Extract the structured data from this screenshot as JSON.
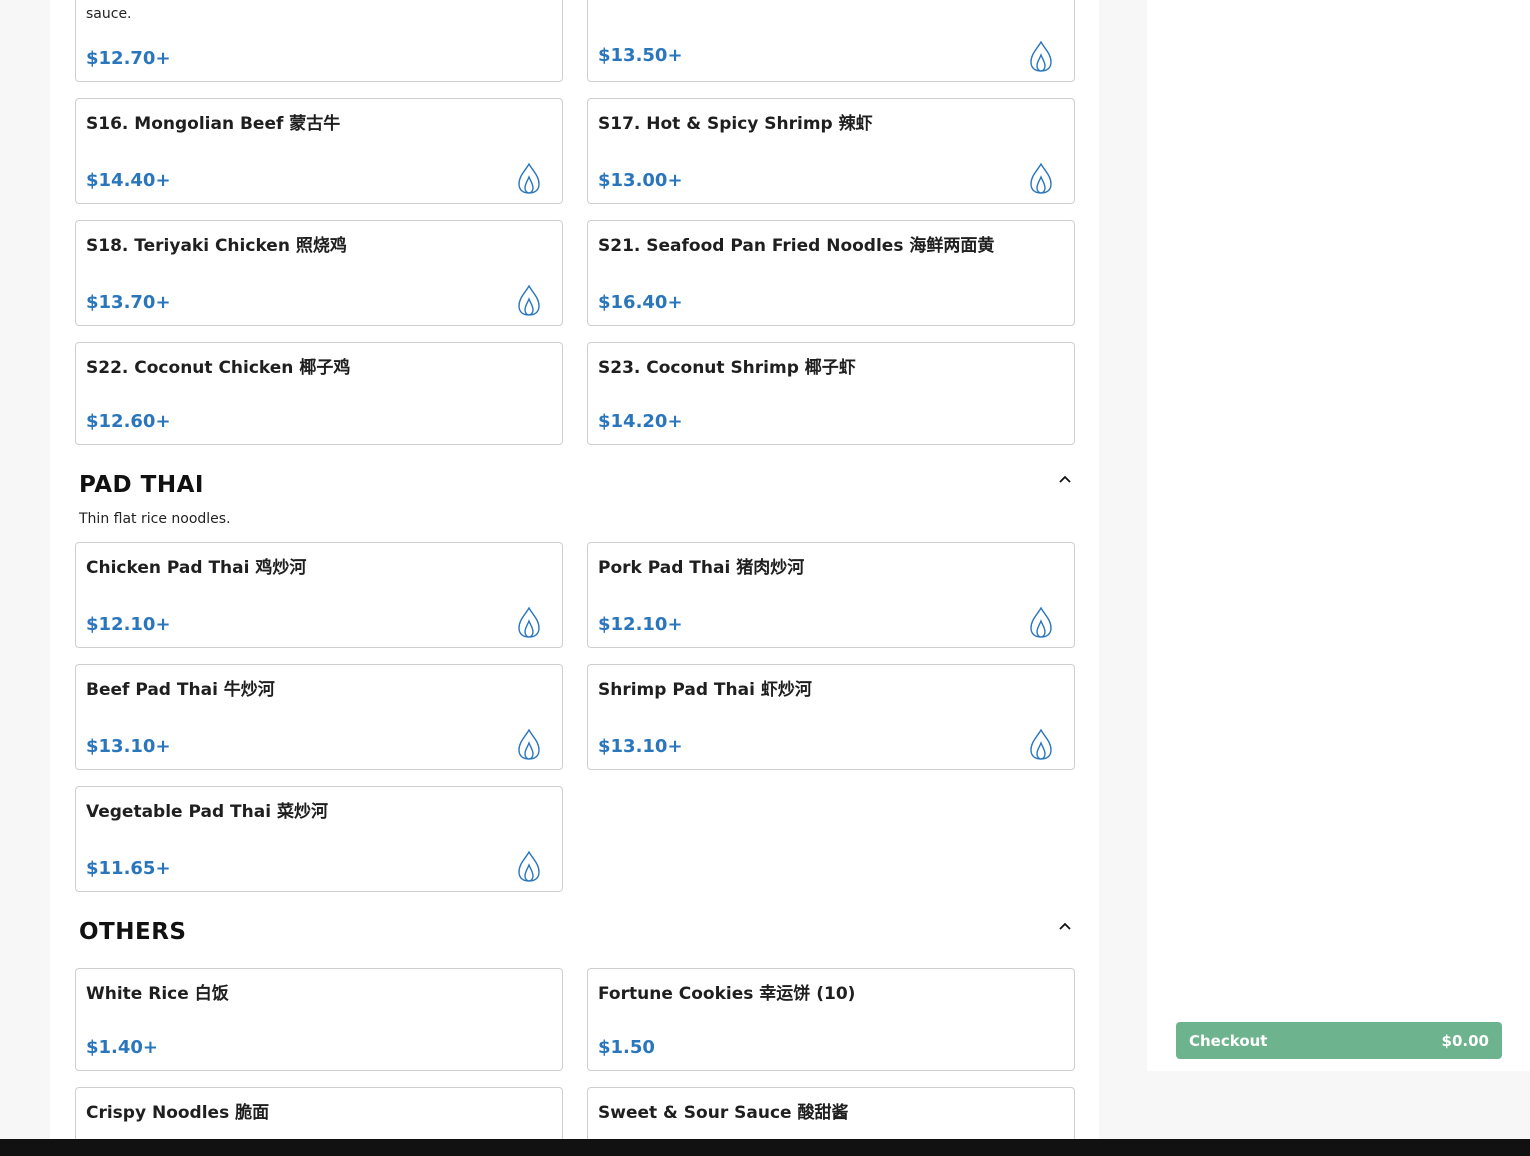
{
  "top_cards": [
    {
      "desc": "sauce.",
      "price": "$12.70+",
      "spicy": false
    },
    {
      "desc": "",
      "price": "$13.50+",
      "spicy": true
    }
  ],
  "sections": [
    {
      "items": [
        {
          "name": "S16. Mongolian Beef 蒙古牛",
          "price": "$14.40+",
          "spicy": true
        },
        {
          "name": "S17. Hot & Spicy Shrimp 辣虾",
          "price": "$13.00+",
          "spicy": true
        },
        {
          "name": "S18. Teriyaki Chicken 照烧鸡",
          "price": "$13.70+",
          "spicy": true
        },
        {
          "name": "S21. Seafood Pan Fried Noodles 海鲜两面黄",
          "price": "$16.40+",
          "spicy": false
        },
        {
          "name": "S22. Coconut Chicken 椰子鸡",
          "price": "$12.60+",
          "spicy": false
        },
        {
          "name": "S23. Coconut Shrimp 椰子虾",
          "price": "$14.20+",
          "spicy": false
        }
      ]
    },
    {
      "title": "PAD THAI",
      "description": "Thin flat rice noodles.",
      "items": [
        {
          "name": "Chicken Pad Thai 鸡炒河",
          "price": "$12.10+",
          "spicy": true
        },
        {
          "name": "Pork Pad Thai 猪肉炒河",
          "price": "$12.10+",
          "spicy": true
        },
        {
          "name": "Beef Pad Thai 牛炒河",
          "price": "$13.10+",
          "spicy": true
        },
        {
          "name": "Shrimp Pad Thai 虾炒河",
          "price": "$13.10+",
          "spicy": true
        },
        {
          "name": "Vegetable Pad Thai 菜炒河",
          "price": "$11.65+",
          "spicy": true
        }
      ]
    },
    {
      "title": "OTHERS",
      "items": [
        {
          "name": "White Rice 白饭",
          "price": "$1.40+",
          "spicy": false
        },
        {
          "name": "Fortune Cookies 幸运饼 (10)",
          "price": "$1.50",
          "spicy": false
        },
        {
          "name": "Crispy Noodles 脆面",
          "price": "",
          "spicy": false
        },
        {
          "name": "Sweet & Sour Sauce 酸甜酱",
          "price": "",
          "spicy": false
        }
      ]
    }
  ],
  "checkout": {
    "label": "Checkout",
    "total": "$0.00"
  },
  "colors": {
    "price": "#2a76bd",
    "checkout": "#6db38d"
  },
  "icons": {
    "spicy": "flame-icon",
    "collapse": "chevron-up-icon"
  }
}
